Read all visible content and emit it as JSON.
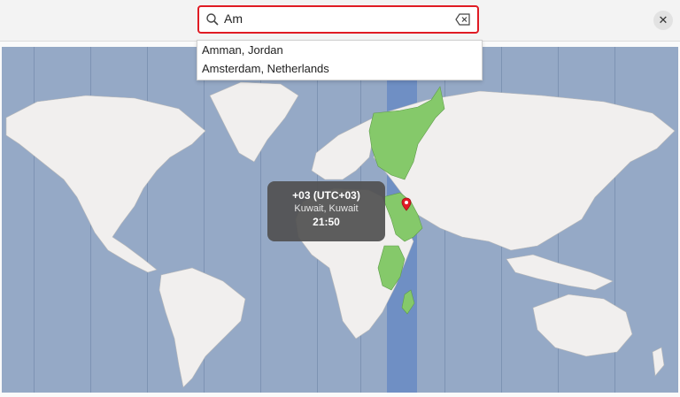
{
  "search": {
    "value": "Am"
  },
  "suggestions": [
    {
      "label": "Amman, Jordan"
    },
    {
      "label": "Amsterdam, Netherlands"
    }
  ],
  "selected_zone": {
    "offset": "+03 (UTC+03)",
    "location": "Kuwait, Kuwait",
    "time": "21:50"
  },
  "colors": {
    "ocean": "#95a9c6",
    "land": "#f1efee",
    "highlight_land": "#85c96a",
    "highlight_band": "#6f8fc4",
    "search_border": "#e01b24"
  },
  "icons": {
    "search": "search-icon",
    "clear": "backspace-icon",
    "close": "close-icon",
    "pin": "map-pin-icon"
  }
}
